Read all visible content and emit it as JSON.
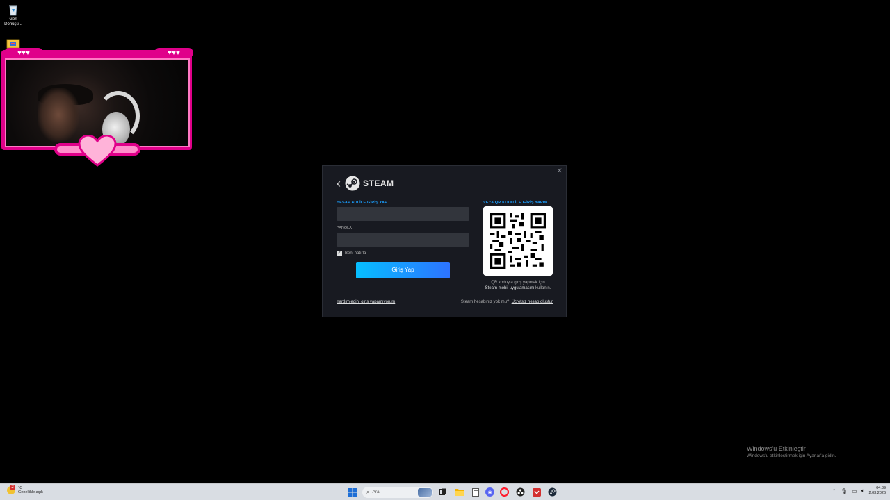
{
  "desktop": {
    "recycle_bin_label": "Geri Dönüşü...",
    "second_icon_label": ""
  },
  "steam_dialog": {
    "brand": "STEAM",
    "account_label": "HESAP ADI İLE GİRİŞ YAP",
    "account_value": "",
    "password_label": "PAROLA",
    "password_value": "",
    "remember_label": "Beni hatırla",
    "remember_checked": true,
    "login_button": "Giriş Yap",
    "qr_label": "VEYA QR KODU İLE GİRİŞ YAPIN",
    "qr_text_1": "QR koduyla giriş yapmak için",
    "qr_link": "Steam mobil uygulamasını",
    "qr_text_2": " kullanın.",
    "help_link": "Yardım edin, giriş yapamıyorum",
    "no_account_text": "Steam hesabınız yok mu?",
    "create_link": "Ücretsiz hesap oluştur",
    "close_icon": "close-icon"
  },
  "activation": {
    "title": "Windows'u Etkinleştir",
    "subtitle": "Windows'u etkinleştirmek için Ayarlar'a gidin."
  },
  "taskbar": {
    "weather_temp": "°C",
    "weather_badge": "2",
    "weather_desc": "Genellikle açık",
    "search_placeholder": "Ara",
    "time": "04:39",
    "date": "2.03.2026",
    "apps": [
      "start-icon",
      "search-icon",
      "widgets-icon",
      "task-view-icon",
      "file-explorer-icon",
      "notepad-icon",
      "discord-icon",
      "opera-icon",
      "obs-icon",
      "pdf-icon",
      "steam-icon"
    ]
  },
  "colors": {
    "steam_blue": "#1a9fff",
    "dialog_bg": "#181a21",
    "overlay_pink": "#e0008a"
  }
}
